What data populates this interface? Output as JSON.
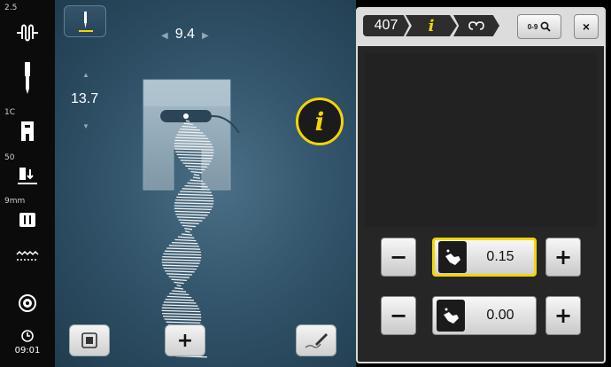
{
  "sidebar": {
    "needle_position": "2.5",
    "presser_foot": "1C",
    "tension": "50",
    "stitch_width_max": "9mm",
    "time": "09:01"
  },
  "main": {
    "stitch_width": "9.4",
    "stitch_length": "13.7",
    "info_label": "i"
  },
  "panel": {
    "breadcrumb": [
      "407",
      "i"
    ],
    "search_label": "0-9",
    "close_label": "×",
    "rows": [
      {
        "minus": "−",
        "value": "0.15",
        "plus": "+"
      },
      {
        "minus": "−",
        "value": "0.00",
        "plus": "+"
      }
    ]
  },
  "buttons": {
    "add": "+"
  },
  "colors": {
    "accent": "#f2d600",
    "panel_header": "#dcdcdc",
    "stitch_area": "#2f5066"
  }
}
